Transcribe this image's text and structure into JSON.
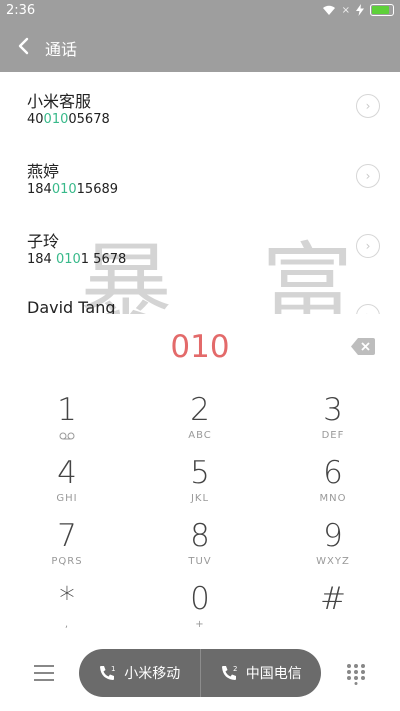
{
  "status": {
    "time": "2:36",
    "signal_mark": "×",
    "icons": [
      "wifi-icon",
      "signal-icon",
      "charging-icon",
      "battery-icon"
    ],
    "battery_color": "#5ed03a"
  },
  "header": {
    "title": "通话",
    "back_icon": "chevron-left-icon"
  },
  "contacts": [
    {
      "name": "小米客服",
      "number_pre": "40",
      "number_match": "010",
      "number_post": "05678"
    },
    {
      "name": "燕婷",
      "number_pre": "184",
      "number_match": "010",
      "number_post": "15689"
    },
    {
      "name": "子玲",
      "number_pre": "184 ",
      "number_match": "010",
      "number_post": "1 5678"
    },
    {
      "name": "David Tang",
      "number_pre": "",
      "number_match": "",
      "number_post": ""
    }
  ],
  "watermark": "暴 富",
  "info_icon": "›",
  "dialpad": {
    "dialed": "010",
    "keys": [
      {
        "digit": "1",
        "letters": ""
      },
      {
        "digit": "2",
        "letters": "ABC"
      },
      {
        "digit": "3",
        "letters": "DEF"
      },
      {
        "digit": "4",
        "letters": "GHI"
      },
      {
        "digit": "5",
        "letters": "JKL"
      },
      {
        "digit": "6",
        "letters": "MNO"
      },
      {
        "digit": "7",
        "letters": "PQRS"
      },
      {
        "digit": "8",
        "letters": "TUV"
      },
      {
        "digit": "9",
        "letters": "WXYZ"
      },
      {
        "digit": "*",
        "letters": ","
      },
      {
        "digit": "0",
        "letters": "+"
      },
      {
        "digit": "#",
        "letters": ""
      }
    ]
  },
  "bottom": {
    "sim1_label": "小米移动",
    "sim2_label": "中国电信",
    "sim1_badge": "1",
    "sim2_badge": "2"
  },
  "colors": {
    "accent": "#e36a6a",
    "match": "#38b98a",
    "header_bg": "#9e9e9e",
    "call_bg": "#6b6b6b"
  }
}
